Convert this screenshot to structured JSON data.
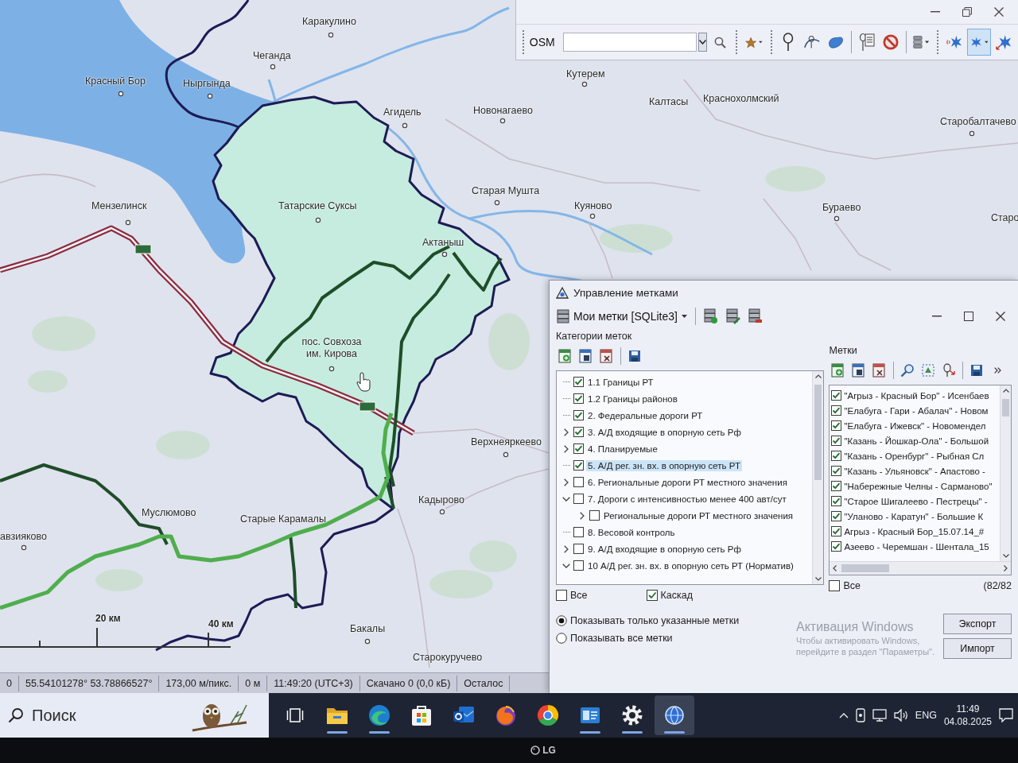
{
  "map": {
    "places": [
      "Каракулино",
      "Чеганда",
      "Красный Бор",
      "Ныргында",
      "Агидель",
      "Новонагаево",
      "Кутерем",
      "Калтасы",
      "Краснохолмский",
      "Старобалтачево",
      "Мензелинск",
      "Татарские Суксы",
      "Старая Мушта",
      "Куяново",
      "Бураево",
      "Старо",
      "Актаныш",
      "пос. Совхоза им. Кирова",
      "Верхнеяркеево",
      "Кадырово",
      "Муслюмово",
      "Старые Карамалы",
      "авзияково",
      "Бакалы",
      "Старокуручево"
    ],
    "scale_labels": [
      "20 км",
      "40 км"
    ]
  },
  "toolbar": {
    "map_source": "OSM",
    "modes": [
      {
        "kind": "signal",
        "selected": false
      },
      {
        "kind": "plain",
        "selected": true
      },
      {
        "kind": "arrow",
        "selected": false
      }
    ]
  },
  "status_bar": [
    "0",
    "55.54101278° 53.78866527°",
    "173,00 м/пикс.",
    "0 м",
    "11:49:20 (UTC+3)",
    "Скачано 0 (0,0 кБ)",
    "Осталос"
  ],
  "dialog": {
    "title": "Управление метками",
    "database": "Мои метки [SQLite3]",
    "categories": {
      "label": "Категории меток",
      "items": [
        {
          "label": "1.1 Границы РТ",
          "checked": true,
          "kind": "leaf",
          "selected": false
        },
        {
          "label": "1.2 Границы районов",
          "checked": true,
          "kind": "leaf",
          "selected": false
        },
        {
          "label": "2. Федеральные дороги РТ",
          "checked": true,
          "kind": "leaf",
          "selected": false
        },
        {
          "label": "3. А/Д входящие в опорную сеть Рф",
          "checked": true,
          "kind": "group",
          "expanded": false,
          "selected": false
        },
        {
          "label": "4. Планируемые",
          "checked": true,
          "kind": "group",
          "expanded": false,
          "selected": false
        },
        {
          "label": "5. А/Д рег. зн. вх. в опорную сеть РТ",
          "checked": true,
          "kind": "leaf",
          "selected": true
        },
        {
          "label": "6. Региональные дороги РТ местного значения",
          "checked": false,
          "kind": "group",
          "expanded": false,
          "selected": false
        },
        {
          "label": "7. Дороги с интенсивностью менее 400 авт/сут",
          "checked": false,
          "kind": "group",
          "expanded": true,
          "selected": false,
          "children": [
            {
              "label": "Региональные дороги РТ местного значения",
              "checked": false,
              "kind": "group",
              "expanded": false,
              "selected": false
            }
          ]
        },
        {
          "label": "8. Весовой контроль",
          "checked": false,
          "kind": "leaf",
          "selected": false
        },
        {
          "label": "9. А/Д входящие в опорную сеть Рф",
          "checked": false,
          "kind": "group",
          "expanded": false,
          "selected": false
        },
        {
          "label": "10 А/Д рег. зн. вх. в опорную сеть РТ (Норматив)",
          "checked": false,
          "kind": "group",
          "expanded": true,
          "selected": false
        }
      ],
      "all": {
        "label": "Все",
        "checked": false
      },
      "cascade": {
        "label": "Каскад",
        "checked": true
      }
    },
    "marks": {
      "label": "Метки",
      "items": [
        {
          "text": "\"Агрыз - Красный Бор\" - Исенбаев",
          "checked": true
        },
        {
          "text": "\"Елабуга - Гари - Абалач\" - Новом",
          "checked": true
        },
        {
          "text": "\"Елабуга - Ижевск\" - Новомендел",
          "checked": true
        },
        {
          "text": "\"Казань - Йошкар-Ола\" - Большой",
          "checked": true
        },
        {
          "text": "\"Казань - Оренбург\" - Рыбная Сл",
          "checked": true
        },
        {
          "text": "\"Казань - Ульяновск\" - Апастово -",
          "checked": true
        },
        {
          "text": "\"Набережные Челны - Сарманово\"",
          "checked": true
        },
        {
          "text": "\"Старое Шигалеево - Пестрецы\" -",
          "checked": true
        },
        {
          "text": "\"Уланово - Каратун\" - Большие К",
          "checked": true
        },
        {
          "text": "Агрыз - Красный Бор_15.07.14_#",
          "checked": true
        },
        {
          "text": "Азеево - Черемшан - Шентала_15",
          "checked": true
        }
      ],
      "all": {
        "label": "Все",
        "checked": false
      },
      "count": "(82/82"
    },
    "display_options": [
      {
        "label": "Показывать только указанные метки",
        "selected": true
      },
      {
        "label": "Показывать все метки",
        "selected": false
      }
    ],
    "buttons": [
      "Экспорт",
      "Импорт"
    ]
  },
  "activation_notice": {
    "title": "Активация Windows",
    "text": "Чтобы активировать Windows, перейдите в раздел \"Параметры\"."
  },
  "taskbar": {
    "search_placeholder": "Поиск",
    "apps": [
      {
        "kind": "task-view",
        "running": false,
        "active": false
      },
      {
        "kind": "folder",
        "running": true,
        "active": false
      },
      {
        "kind": "swirl",
        "running": true,
        "active": false
      },
      {
        "kind": "bag",
        "running": false,
        "active": false
      },
      {
        "kind": "mail",
        "running": false,
        "active": false
      },
      {
        "kind": "fox",
        "running": false,
        "active": false
      },
      {
        "kind": "ring",
        "running": false,
        "active": false
      },
      {
        "kind": "panel",
        "running": true,
        "active": false
      },
      {
        "kind": "gear",
        "running": true,
        "active": false
      },
      {
        "kind": "globe",
        "running": true,
        "active": true
      }
    ],
    "language": "ENG",
    "time": "11:49",
    "date": "04.08.2025"
  },
  "monitor": {
    "brand": "LG"
  }
}
